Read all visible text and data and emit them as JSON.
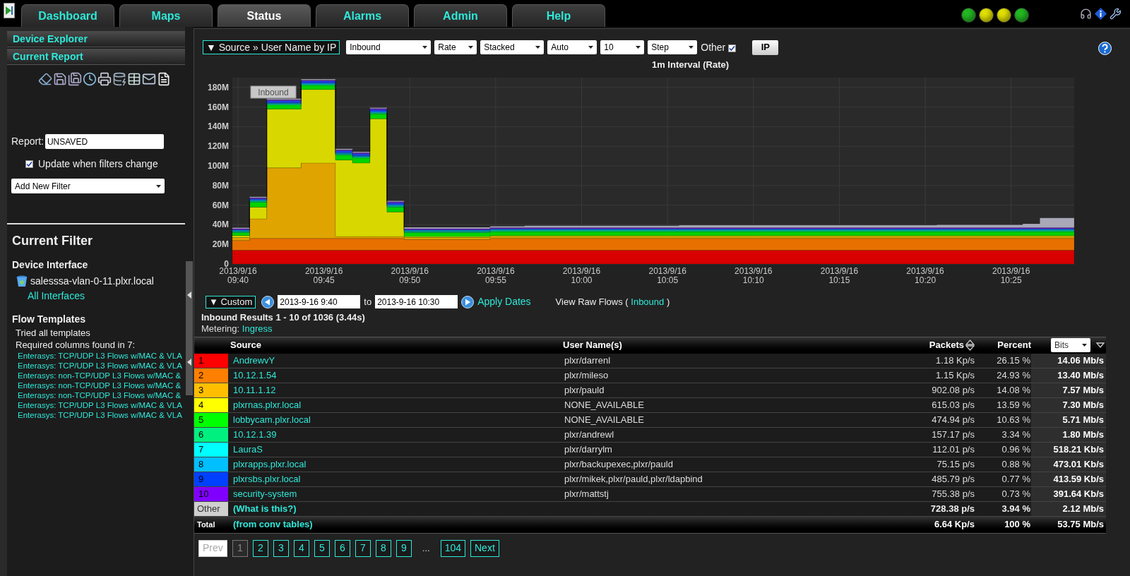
{
  "top_bar": {
    "tabs": [
      {
        "label": "Dashboard",
        "selected": false
      },
      {
        "label": "Maps",
        "selected": false
      },
      {
        "label": "Status",
        "selected": true
      },
      {
        "label": "Alarms",
        "selected": false
      },
      {
        "label": "Admin",
        "selected": false
      },
      {
        "label": "Help",
        "selected": false
      }
    ],
    "status_lights": [
      {
        "color": "#22b822"
      },
      {
        "color": "#e0e000"
      },
      {
        "color": "#e0e000"
      },
      {
        "color": "#22b822"
      }
    ]
  },
  "sidebar": {
    "sections": [
      {
        "label": "Device Explorer"
      },
      {
        "label": "Current Report"
      }
    ],
    "report": {
      "label": "Report:",
      "value": "UNSAVED"
    },
    "update_checkbox": {
      "label": "Update when filters change",
      "checked": true
    },
    "filter_select": {
      "value": "Add New Filter"
    },
    "current_filter": {
      "title": "Current Filter",
      "device_heading": "Device Interface",
      "device": "salesssa-vlan-0-11.plxr.local",
      "interfaces_link": "All Interfaces",
      "templates_heading": "Flow Templates",
      "lines": [
        "Tried all templates",
        "Required columns found in 7:"
      ],
      "templates": [
        "Enterasys: TCP/UDP L3 Flows w/MAC & VLA",
        "Enterasys: TCP/UDP L3 Flows w/MAC & VLA",
        "Enterasys: non-TCP/UDP L3 Flows w/MAC &",
        "Enterasys: non-TCP/UDP L3 Flows w/MAC &",
        "Enterasys: non-TCP/UDP L3 Flows w/MAC &",
        "Enterasys: TCP/UDP L3 Flows w/MAC & VLA",
        "Enterasys: TCP/UDP L3 Flows w/MAC & VLA"
      ]
    }
  },
  "report_bar": {
    "source_button": "▼ Source » User Name by IP",
    "selects": [
      "Inbound",
      "Rate",
      "Stacked",
      "Auto",
      "10",
      "Step"
    ],
    "other": {
      "label": "Other",
      "checked": true
    },
    "ip_button": "IP"
  },
  "chart": {
    "chart_data": {
      "type": "area",
      "title": "1m Interval (Rate)",
      "stacked": true,
      "grid": true,
      "ylim": [
        0,
        190
      ],
      "categories": [
        "2013/9/16 09:40",
        null,
        null,
        null,
        null,
        "2013/9/16 09:45",
        null,
        null,
        null,
        null,
        "2013/9/16 09:50",
        null,
        null,
        null,
        null,
        "2013/9/16 09:55",
        null,
        null,
        null,
        null,
        "2013/9/16 10:00",
        null,
        null,
        null,
        null,
        "2013/9/16 10:05",
        null,
        null,
        null,
        null,
        "2013/9/16 10:10",
        null,
        null,
        null,
        null,
        "2013/9/16 10:15",
        null,
        null,
        null,
        null,
        "2013/9/16 10:20",
        null,
        null,
        null,
        null,
        "2013/9/16 10:25",
        null,
        null,
        null,
        null
      ],
      "yticks": [
        {
          "value": 0,
          "label": "0"
        },
        {
          "value": 20,
          "label": "20M"
        },
        {
          "value": 40,
          "label": "40M"
        },
        {
          "value": 60,
          "label": "60M"
        },
        {
          "value": 80,
          "label": "80M"
        },
        {
          "value": 100,
          "label": "100M"
        },
        {
          "value": 120,
          "label": "120M"
        },
        {
          "value": 140,
          "label": "140M"
        },
        {
          "value": 160,
          "label": "160M"
        },
        {
          "value": 180,
          "label": "180M"
        }
      ],
      "series": [
        {
          "color": "#d80000",
          "values": [
            14,
            14,
            14,
            14,
            14,
            14,
            14,
            14,
            14,
            14,
            14,
            14,
            14,
            14,
            14,
            14,
            14,
            14,
            14,
            14,
            14,
            14,
            14,
            14,
            14,
            14,
            14,
            14,
            14,
            14,
            14,
            14,
            14,
            14,
            14,
            14,
            14,
            14,
            14,
            14,
            14,
            14,
            14,
            14,
            14,
            14,
            14,
            14,
            14,
            14
          ]
        },
        {
          "color": "#e87000",
          "values": [
            10,
            12,
            12,
            12,
            12,
            12,
            12,
            12,
            12,
            12,
            11,
            11,
            11,
            11,
            11,
            12,
            12,
            12,
            12,
            12,
            12,
            12,
            12,
            12,
            12,
            12,
            12,
            12,
            12,
            12,
            12,
            12,
            12,
            12,
            12,
            12,
            12,
            12,
            12,
            12,
            12,
            12,
            12,
            12,
            12,
            12,
            12,
            12,
            12,
            12
          ]
        },
        {
          "color": "#e0a400",
          "values": [
            3,
            20,
            72,
            72,
            77,
            77,
            2,
            2,
            2,
            2,
            2,
            2,
            2,
            2,
            2,
            2,
            2,
            2,
            2,
            2,
            2,
            2,
            2,
            2,
            2,
            2,
            2,
            2,
            2,
            2,
            2,
            2,
            2,
            2,
            2,
            2,
            2,
            2,
            2,
            2,
            2,
            2,
            2,
            2,
            2,
            2,
            2,
            2,
            2,
            2
          ]
        },
        {
          "color": "#d8d800",
          "values": [
            2,
            12,
            60,
            60,
            75,
            75,
            78,
            75,
            120,
            25,
            1,
            1,
            1,
            1,
            1,
            1,
            1,
            1,
            1,
            1,
            1,
            1,
            1,
            1,
            1,
            1,
            1,
            1,
            1,
            1,
            1,
            1,
            1,
            1,
            1,
            1,
            1,
            1,
            1,
            1,
            1,
            1,
            1,
            1,
            1,
            1,
            1,
            1,
            1,
            1
          ]
        },
        {
          "color": "#00d400",
          "values": [
            3,
            5,
            4,
            4,
            4,
            4,
            5,
            5,
            5,
            5,
            4,
            4,
            4,
            4,
            4,
            4,
            4,
            4,
            4,
            4,
            4,
            4,
            4,
            4,
            4,
            4,
            4,
            4,
            4,
            4,
            4,
            4,
            4,
            4,
            4,
            4,
            4,
            4,
            4,
            4,
            4,
            4,
            4,
            4,
            4,
            4,
            4,
            4,
            4,
            4
          ]
        },
        {
          "color": "#00e080",
          "values": [
            1,
            1,
            1,
            1,
            1,
            1,
            1,
            1,
            1,
            1,
            1,
            1,
            1,
            1,
            1,
            1,
            1,
            1,
            1,
            1,
            1,
            1,
            1,
            1,
            1,
            1,
            1,
            1,
            1,
            1,
            1,
            1,
            1,
            1,
            1,
            1,
            1,
            1,
            1,
            1,
            1,
            1,
            1,
            1,
            1,
            1,
            1,
            1,
            1,
            1
          ]
        },
        {
          "color": "#00e0e0",
          "values": [
            0.5,
            0.5,
            0.5,
            0.5,
            0.5,
            0.5,
            0.5,
            0.5,
            0.5,
            0.5,
            0.5,
            0.5,
            0.5,
            0.5,
            0.5,
            0.5,
            0.5,
            0.5,
            0.5,
            0.5,
            0.5,
            0.5,
            0.5,
            0.5,
            0.5,
            0.5,
            0.5,
            0.5,
            0.5,
            0.5,
            0.5,
            0.5,
            0.5,
            0.5,
            0.5,
            0.5,
            0.5,
            0.5,
            0.5,
            0.5,
            0.5,
            0.5,
            0.5,
            0.5,
            0.5,
            0.5,
            0.5,
            0.5,
            0.5,
            0.5
          ]
        },
        {
          "color": "#00a8e8",
          "values": [
            1,
            1,
            1,
            1,
            1,
            1,
            1,
            1,
            1,
            1,
            1,
            1,
            1,
            1,
            1,
            1,
            1,
            1,
            1,
            1,
            1,
            1,
            1,
            1,
            1,
            1,
            1,
            1,
            1,
            1,
            1,
            1,
            1,
            1,
            1,
            1,
            1,
            1,
            1,
            1,
            1,
            1,
            1,
            1,
            1,
            1,
            1,
            1,
            1,
            1
          ]
        },
        {
          "color": "#2040f0",
          "values": [
            0.5,
            1,
            2,
            2,
            2,
            2,
            2,
            2,
            2,
            2,
            0.5,
            0.5,
            0.5,
            0.5,
            0.5,
            0.5,
            0.5,
            0.5,
            0.5,
            0.5,
            0.5,
            0.5,
            0.5,
            0.5,
            0.5,
            0.5,
            0.5,
            0.5,
            0.5,
            0.5,
            0.5,
            0.5,
            0.5,
            0.5,
            0.5,
            0.5,
            0.5,
            0.5,
            0.5,
            0.5,
            0.5,
            0.5,
            0.5,
            0.5,
            0.5,
            0.5,
            0.5,
            0.5,
            0.5,
            0.5
          ]
        },
        {
          "color": "#7a2ee0",
          "values": [
            1,
            1,
            1,
            1,
            1,
            1,
            1,
            1,
            1,
            1,
            1,
            1,
            1,
            1,
            1,
            1,
            1,
            1,
            1,
            1,
            1,
            1,
            1,
            1,
            1,
            1,
            1,
            1,
            1,
            1,
            1,
            1,
            1,
            1,
            1,
            1,
            1,
            1,
            1,
            1,
            1,
            1,
            1,
            1,
            1,
            1,
            1,
            1,
            1,
            1
          ]
        },
        {
          "color": "#a8a8b8",
          "values": [
            1,
            1,
            1,
            1,
            1,
            1,
            1,
            1,
            1,
            1,
            1.5,
            1.5,
            1.5,
            1.5,
            1.5,
            1.5,
            1.5,
            2,
            2,
            2,
            2,
            2,
            2,
            2,
            2,
            2,
            2.5,
            2.5,
            2.5,
            2.5,
            2.5,
            2.5,
            2.5,
            2.5,
            2.5,
            2.5,
            2.5,
            2.5,
            2.5,
            2.5,
            2.5,
            3,
            3,
            3,
            3,
            3,
            4,
            10,
            10,
            3
          ]
        }
      ],
      "annotations": [
        "Inbound"
      ]
    }
  },
  "dates": {
    "range_button": "▼ Custom",
    "from": "2013-9-16 9:40",
    "to_label": "to",
    "to": "2013-9-16 10:30",
    "apply": "Apply Dates",
    "raw_flows": {
      "before": "View Raw Flows (",
      "link": "Inbound",
      "after": ")"
    }
  },
  "results": {
    "title": "Inbound Results 1 - 10 of 1036 (3.44s)",
    "metering_label": "Metering:",
    "metering_link": "Ingress"
  },
  "table": {
    "columns": [
      "Source",
      "User Name(s)",
      "Packets",
      "Percent"
    ],
    "unit_select": "Bits",
    "rows": [
      {
        "index": "1",
        "color": "#ff0000",
        "source": "AndrewvY",
        "users": "plxr/darrenl",
        "packets": "1.18 Kp/s",
        "percent": "26.15 %",
        "bits": "14.06 Mb/s"
      },
      {
        "index": "2",
        "color": "#ff7f00",
        "source": "10.12.1.54",
        "users": "plxr/mileso",
        "packets": "1.15 Kp/s",
        "percent": "24.93 %",
        "bits": "13.40 Mb/s"
      },
      {
        "index": "3",
        "color": "#ffbf00",
        "source": "10.11.1.12",
        "users": "plxr/pauld",
        "packets": "902.08 p/s",
        "percent": "14.08 %",
        "bits": "7.57 Mb/s"
      },
      {
        "index": "4",
        "color": "#ffff00",
        "source": "plxrnas.plxr.local",
        "users": "NONE_AVAILABLE",
        "packets": "615.03 p/s",
        "percent": "13.59 %",
        "bits": "7.30 Mb/s"
      },
      {
        "index": "5",
        "color": "#00ff00",
        "source": "lobbycam.plxr.local",
        "users": "NONE_AVAILABLE",
        "packets": "474.94 p/s",
        "percent": "10.63 %",
        "bits": "5.71 Mb/s"
      },
      {
        "index": "6",
        "color": "#00f080",
        "source": "10.12.1.39",
        "users": "plxr/andrewl",
        "packets": "157.17 p/s",
        "percent": "3.34 %",
        "bits": "1.80 Mb/s"
      },
      {
        "index": "7",
        "color": "#00ffff",
        "source": "LauraS",
        "users": "plxr/darrylm",
        "packets": "112.01 p/s",
        "percent": "0.96 %",
        "bits": "518.21 Kb/s"
      },
      {
        "index": "8",
        "color": "#00bfff",
        "source": "plxrapps.plxr.local",
        "users": "plxr/backupexec,plxr/pauld",
        "packets": "75.15 p/s",
        "percent": "0.88 %",
        "bits": "473.01 Kb/s"
      },
      {
        "index": "9",
        "color": "#0040ff",
        "source": "plxrsbs.plxr.local",
        "users": "plxr/mikek,plxr/pauld,plxr/ldapbind",
        "packets": "485.79 p/s",
        "percent": "0.77 %",
        "bits": "413.59 Kb/s"
      },
      {
        "index": "10",
        "color": "#8000ff",
        "source": "security-system",
        "users": "plxr/mattstj",
        "packets": "755.38 p/s",
        "percent": "0.73 %",
        "bits": "391.64 Kb/s"
      }
    ],
    "other_row": {
      "index": "Other",
      "source": "(What is this?)",
      "packets": "728.38 p/s",
      "percent": "3.94 %",
      "bits": "2.12 Mb/s"
    },
    "total_row": {
      "index": "Total",
      "source": "(from conv tables)",
      "packets": "6.64 Kp/s",
      "percent": "100 %",
      "bits": "53.75 Mb/s"
    }
  },
  "pagination": [
    {
      "label": "Prev",
      "kind": "nav",
      "disabled": true
    },
    {
      "label": "1",
      "kind": "page",
      "selected": true
    },
    {
      "label": "2",
      "kind": "page",
      "selected": false
    },
    {
      "label": "3",
      "kind": "page",
      "selected": false
    },
    {
      "label": "4",
      "kind": "page",
      "selected": false
    },
    {
      "label": "5",
      "kind": "page",
      "selected": false
    },
    {
      "label": "6",
      "kind": "page",
      "selected": false
    },
    {
      "label": "7",
      "kind": "page",
      "selected": false
    },
    {
      "label": "8",
      "kind": "page",
      "selected": false
    },
    {
      "label": "9",
      "kind": "page",
      "selected": false
    },
    {
      "label": "...",
      "kind": "gap"
    },
    {
      "label": "104",
      "kind": "page",
      "selected": false
    },
    {
      "label": "Next",
      "kind": "nav",
      "disabled": false
    }
  ]
}
